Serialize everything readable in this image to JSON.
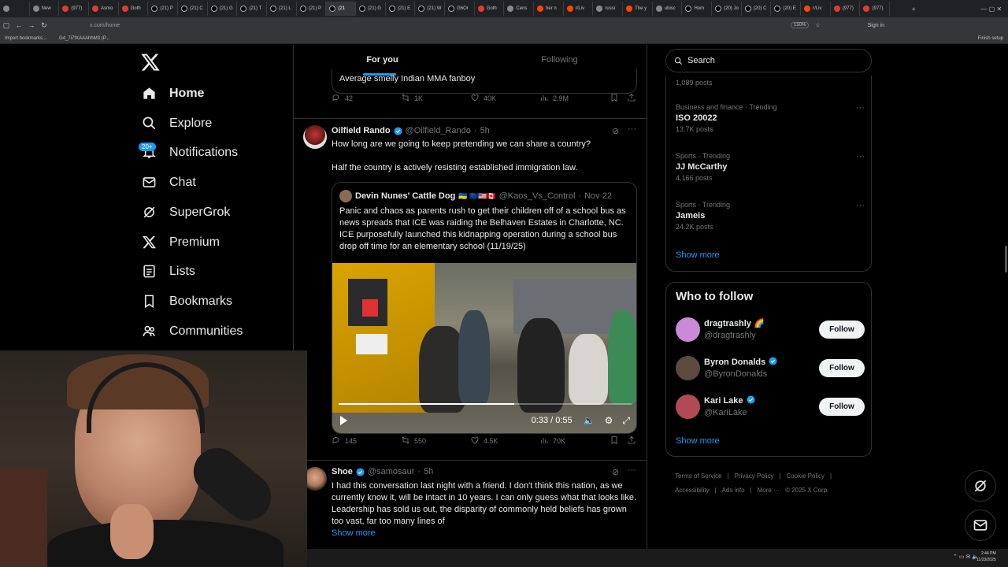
{
  "browser": {
    "tabs": [
      {
        "label": "",
        "kind": "plain"
      },
      {
        "label": "New",
        "kind": "plain"
      },
      {
        "label": "(977)",
        "kind": "yt"
      },
      {
        "label": "Asmo",
        "kind": "yt"
      },
      {
        "label": "Goth",
        "kind": "yt"
      },
      {
        "label": "(21) P",
        "kind": "x"
      },
      {
        "label": "(21) C",
        "kind": "x"
      },
      {
        "label": "(21) G",
        "kind": "x"
      },
      {
        "label": "(21) T",
        "kind": "x"
      },
      {
        "label": "(21) L",
        "kind": "x"
      },
      {
        "label": "(21) P",
        "kind": "x"
      },
      {
        "label": "(21",
        "kind": "x",
        "active": true
      },
      {
        "label": "(21) G",
        "kind": "x"
      },
      {
        "label": "(21) E",
        "kind": "x"
      },
      {
        "label": "(21) W",
        "kind": "x"
      },
      {
        "label": "G6Or",
        "kind": "x"
      },
      {
        "label": "Goth",
        "kind": "yt"
      },
      {
        "label": "Cens",
        "kind": "plain"
      },
      {
        "label": "her n",
        "kind": "red"
      },
      {
        "label": "r/Liv",
        "kind": "red"
      },
      {
        "label": "russi",
        "kind": "plain"
      },
      {
        "label": "The y",
        "kind": "red"
      },
      {
        "label": "ubisc",
        "kind": "plain"
      },
      {
        "label": "Hom",
        "kind": "x"
      },
      {
        "label": "(20) Jo",
        "kind": "x"
      },
      {
        "label": "(20) C",
        "kind": "x"
      },
      {
        "label": "(20) E",
        "kind": "x"
      },
      {
        "label": "r/Liv",
        "kind": "red"
      },
      {
        "label": "(977)",
        "kind": "yt"
      },
      {
        "label": "(977)",
        "kind": "yt"
      }
    ],
    "url": "x.com/home",
    "zoom": "150%",
    "sign_in": "Sign in",
    "finish_setup": "Finish setup",
    "bookmarks": [
      "Import bookmarks...",
      "G4_7i7fXAAAhhM3 (P..."
    ]
  },
  "nav": {
    "items": [
      {
        "label": "Home",
        "icon": "home-icon"
      },
      {
        "label": "Explore",
        "icon": "search-icon"
      },
      {
        "label": "Notifications",
        "icon": "bell-icon"
      },
      {
        "label": "Chat",
        "icon": "mail-icon"
      },
      {
        "label": "SuperGrok",
        "icon": "grok-icon"
      },
      {
        "label": "Premium",
        "icon": "x-logo-icon"
      },
      {
        "label": "Lists",
        "icon": "list-icon"
      },
      {
        "label": "Bookmarks",
        "icon": "bookmark-icon"
      },
      {
        "label": "Communities",
        "icon": "people-icon"
      }
    ],
    "notifications_badge": "20+"
  },
  "feed": {
    "tabs": [
      "For you",
      "Following"
    ],
    "prev_quote": "Average smelly Indian MMA fanboy",
    "prev_stats": {
      "replies": "42",
      "reposts": "1K",
      "likes": "40K",
      "views": "2.9M"
    },
    "post1": {
      "name": "Oilfield Rando",
      "handle": "@Oilfield_Rando",
      "time": "5h",
      "line1": "How long are we going to keep pretending we can share a country?",
      "line2": "Half the country is actively resisting established immigration law.",
      "quote": {
        "name": "Devin Nunes' Cattle Dog",
        "flags": "🇺🇦 🇪🇺🇺🇸🇨🇦",
        "handle": "@Kaos_Vs_Control",
        "date": "Nov 22",
        "text": "Panic  and chaos as parents rush to get their children off of a school bus as  news spreads that ICE was raiding the Belhaven Estates in Charlotte, NC.  ICE purposefully launched this kidnapping operation during a school bus drop off time for an elementary school (11/19/25)",
        "video_time": "0:33 / 0:55",
        "video_progress": 0.6
      },
      "stats": {
        "replies": "145",
        "reposts": "550",
        "likes": "4.5K",
        "views": "70K"
      }
    },
    "post2": {
      "name": "Shoe",
      "handle": "@samosaur",
      "time": "5h",
      "text": "I had this conversation last night with a friend. I don't think this nation, as we currently know it, will be intact in 10 years. I can only guess what that looks like. Leadership has sold us out, the disparity of commonly held beliefs has grown too vast, far too many lines of",
      "show_more": "Show more"
    }
  },
  "sidebar": {
    "search_placeholder": "Search",
    "trends": [
      {
        "meta": "",
        "name": "",
        "count": "1,089 posts"
      },
      {
        "meta": "Business and finance · Trending",
        "name": "ISO 20022",
        "count": "13.7K posts"
      },
      {
        "meta": "Sports · Trending",
        "name": "JJ McCarthy",
        "count": "4,166 posts"
      },
      {
        "meta": "Sports · Trending",
        "name": "Jameis",
        "count": "24.2K posts"
      }
    ],
    "trends_show_more": "Show more",
    "who_to_follow": {
      "title": "Who to follow",
      "accounts": [
        {
          "name": "dragtrashly 🌈",
          "handle": "@dragtrashly",
          "verified": false,
          "button": "Follow",
          "color": "#c98ad6"
        },
        {
          "name": "Byron Donalds",
          "handle": "@ByronDonalds",
          "verified": true,
          "button": "Follow",
          "color": "#5b4a3f"
        },
        {
          "name": "Kari Lake",
          "handle": "@KariLake",
          "verified": true,
          "button": "Follow",
          "color": "#b04a55"
        }
      ],
      "show_more": "Show more"
    },
    "footer": [
      "Terms of Service",
      "|",
      "Privacy Policy",
      "|",
      "Cookie Policy",
      "|",
      "Accessibility",
      "|",
      "Ads info",
      "|",
      "More ···",
      "© 2025 X Corp."
    ]
  },
  "taskbar": {
    "time": "2:44 PM",
    "date": "11/23/2025"
  },
  "colors": {
    "accent": "#1d9bf0",
    "bg": "#000000",
    "border": "#2f3336",
    "muted": "#71767b"
  }
}
